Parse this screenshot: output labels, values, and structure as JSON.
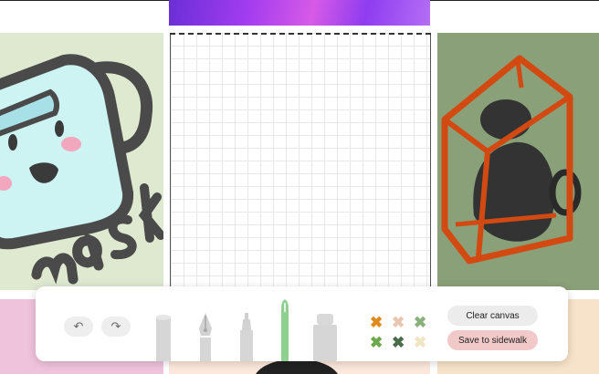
{
  "toolbar": {
    "undo_icon": "undo-icon",
    "redo_icon": "redo-icon",
    "tools": [
      "marker",
      "fountain-pen",
      "highlighter",
      "needle-pen",
      "eraser"
    ],
    "colors": [
      "#e08a1e",
      "#e8c6b2",
      "#8ab07e",
      "#6ca84c",
      "#4a6b4a",
      "#efe4c4"
    ],
    "clear_label": "Clear canvas",
    "save_label": "Save to sidewalk"
  },
  "gallery": {
    "left_art_text": "mask",
    "canvas_grid": true
  }
}
